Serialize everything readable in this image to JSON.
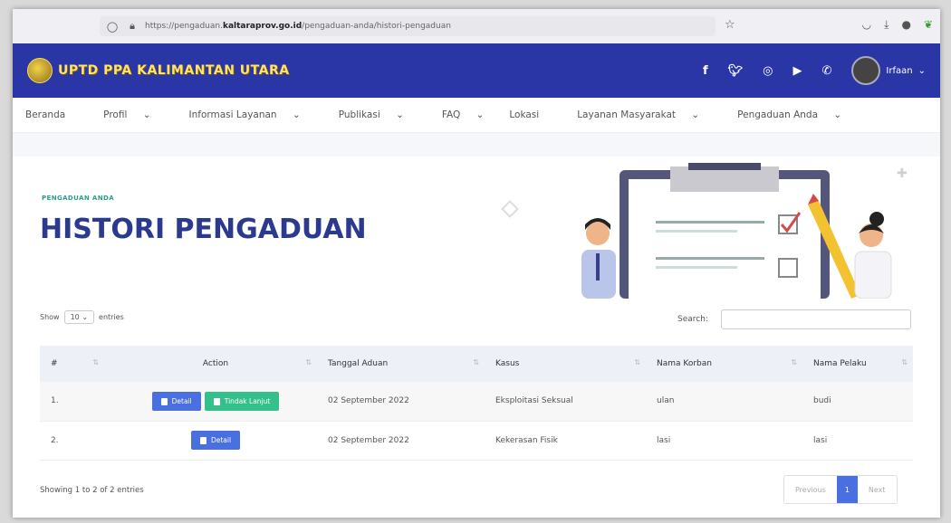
{
  "browser": {
    "url_prefix": "https://pengaduan.",
    "url_domain": "kaltaraprov.go.id",
    "url_suffix": "/pengaduan-anda/histori-pengaduan"
  },
  "header": {
    "site_title": "UPTD PPA KALIMANTAN UTARA",
    "user_name": "Irfaan"
  },
  "nav": {
    "items": [
      "Beranda",
      "Profil",
      "Informasi Layanan",
      "Publikasi",
      "FAQ",
      "Lokasi",
      "Layanan Masyarakat",
      "Pengaduan Anda"
    ]
  },
  "page": {
    "kicker": "PENGADUAN ANDA",
    "title": "HISTORI PENGADUAN"
  },
  "controls": {
    "show_label": "Show",
    "show_value": "10",
    "entries_label": "entries",
    "search_label": "Search:"
  },
  "table": {
    "columns": [
      "#",
      "Action",
      "Tanggal Aduan",
      "Kasus",
      "Nama Korban",
      "Nama Pelaku"
    ],
    "rows": [
      {
        "no": "1.",
        "actions": [
          "Detail",
          "Tindak Lanjut"
        ],
        "date": "02 September 2022",
        "kasus": "Eksploitasi Seksual",
        "korban": "ulan",
        "pelaku": "budi"
      },
      {
        "no": "2.",
        "actions": [
          "Detail"
        ],
        "date": "02 September 2022",
        "kasus": "Kekerasan Fisik",
        "korban": "lasi",
        "pelaku": "lasi"
      }
    ]
  },
  "footer": {
    "info": "Showing 1 to 2 of 2 entries",
    "prev": "Previous",
    "page": "1",
    "next": "Next"
  },
  "colors": {
    "header_bg": "#2b36a6",
    "title": "#2b3a8f",
    "detail_btn": "#4a6fe0",
    "followup_btn": "#34c08a"
  }
}
